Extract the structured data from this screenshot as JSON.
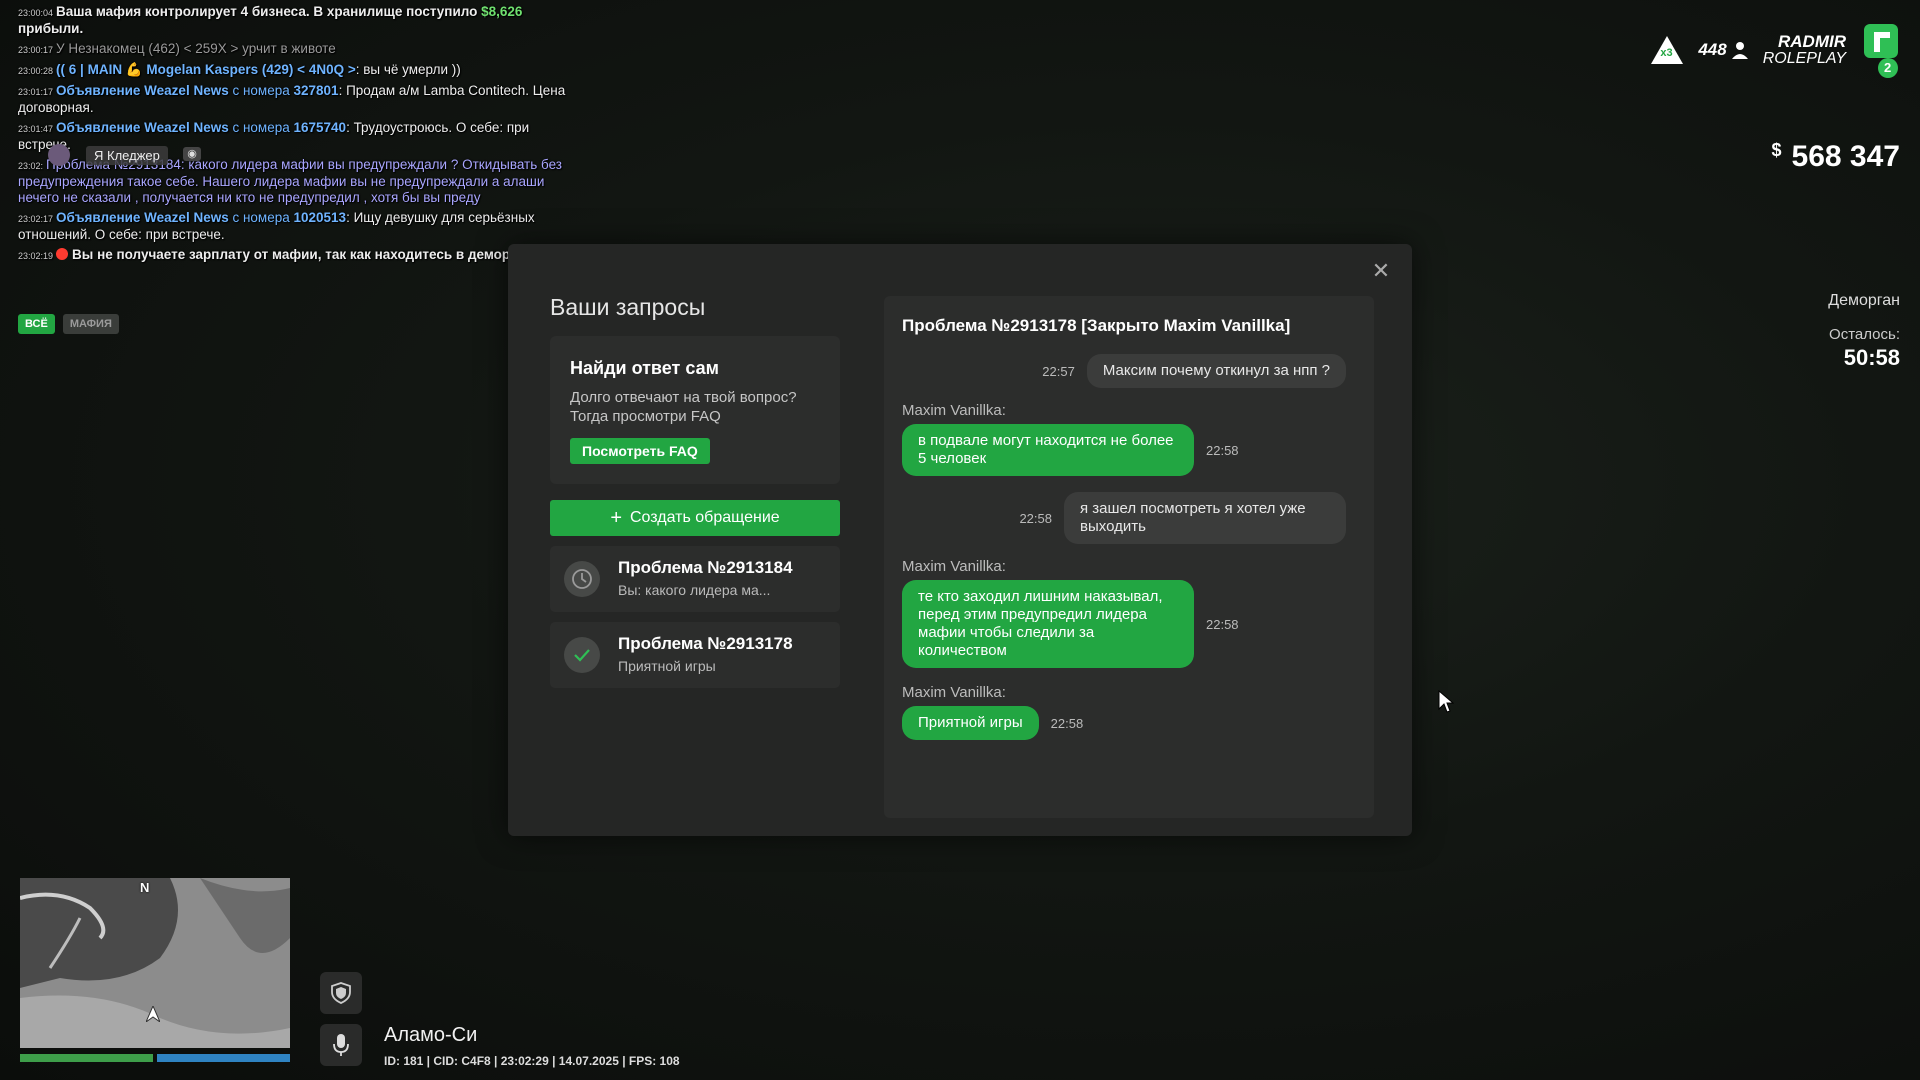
{
  "chat": {
    "lines": [
      {
        "ts": "23:00:04",
        "text": "Ваша мафия контролирует 4 бизнеса. В хранилище поступило ",
        "amount": "$8,626",
        "tail": " прибыли."
      },
      {
        "ts": "23:00:17",
        "text": "У Незнакомец (462) < 259X > урчит в животе"
      },
      {
        "ts": "23:00:28",
        "tag": "(( 6 | MAIN 💪 Mogelan Kaspers (429) < 4N0Q >",
        "text": ": вы чё умерли ))"
      },
      {
        "ts": "23:01:17",
        "ad": "Объявление Weazel News",
        "mid": " с номера ",
        "num": "327801",
        "text": ": Продам а/м Lamba Contitech. Цена договорная."
      },
      {
        "ts": "23:01:47",
        "ad": "Объявление Weazel News",
        "mid": " с номера ",
        "num": "1675740",
        "text": ": Трудоустроюсь. О себе: при встрече."
      },
      {
        "ts": "23:02:",
        "text": "Проблема №2913184: какого лидера мафии вы предупреждали ? Откидывать без предупреждения такое себе. Нашего лидера мафии вы не предупреждали а алаши нечего не сказали , получается ни кто не предупредил , хотя бы вы преду"
      },
      {
        "ts": "23:02:17",
        "ad": "Объявление Weazel News",
        "mid": " с номера ",
        "num": "1020513",
        "text": ": Ищу девушку для серьёзных отношений. О себе: при встрече."
      },
      {
        "ts": "23:02:19",
        "text": "Вы не получаете зарплату от мафии, так как находитесь в деморгане."
      }
    ],
    "speaker": "Я Кледжер",
    "tabs": [
      "ВСЁ",
      "МАФИЯ"
    ]
  },
  "hud": {
    "x_badge": "x3",
    "online": "448",
    "brand_line1": "RADMIR",
    "brand_line2": "ROLEPLAY",
    "server_num": "2",
    "currency": "$",
    "money": "568 347",
    "demorgan_title": "Деморган",
    "remaining_label": "Осталось:",
    "remaining_time": "50:58"
  },
  "modal": {
    "title": "Ваши запросы",
    "faq_title": "Найди ответ сам",
    "faq_text": "Долго отвечают на твой вопрос? Тогда просмотри FAQ",
    "faq_button": "Посмотреть FAQ",
    "create_button": "Создать обращение",
    "tickets": [
      {
        "title": "Проблема №2913184",
        "subtitle": "Вы: какого лидера ма...",
        "icon": "clock-icon"
      },
      {
        "title": "Проблема №2913178",
        "subtitle": "Приятной игры",
        "icon": "check-icon"
      }
    ],
    "conversation": {
      "title": "Проблема №2913178 [Закрыто Maxim Vanillka]",
      "messages": [
        {
          "dir": "out",
          "text": "Максим почему откинул за нпп ?",
          "time": "22:57"
        },
        {
          "dir": "in",
          "author": "Maxim Vanillka:",
          "text": "в подвале могут находится не более 5 человек",
          "time": "22:58"
        },
        {
          "dir": "out",
          "text": "я зашел посмотреть я хотел уже выходить",
          "time": "22:58"
        },
        {
          "dir": "in",
          "author": "Maxim Vanillka:",
          "text": "те кто заходил лишним наказывал, перед этим предупредил лидера мафии чтобы следили за количеством",
          "time": "22:58"
        },
        {
          "dir": "in",
          "author": "Maxim Vanillka:",
          "text": "Приятной игры",
          "time": "22:58"
        }
      ]
    }
  },
  "bottom": {
    "compass": "N",
    "location": "Аламо-Си",
    "status": "ID: 181 | CID: C4F8 | 23:02:29 | 14.07.2025 | FPS: 108"
  },
  "colors": {
    "accent": "#22a642",
    "panel": "#252625",
    "card": "#2c2d2c"
  }
}
